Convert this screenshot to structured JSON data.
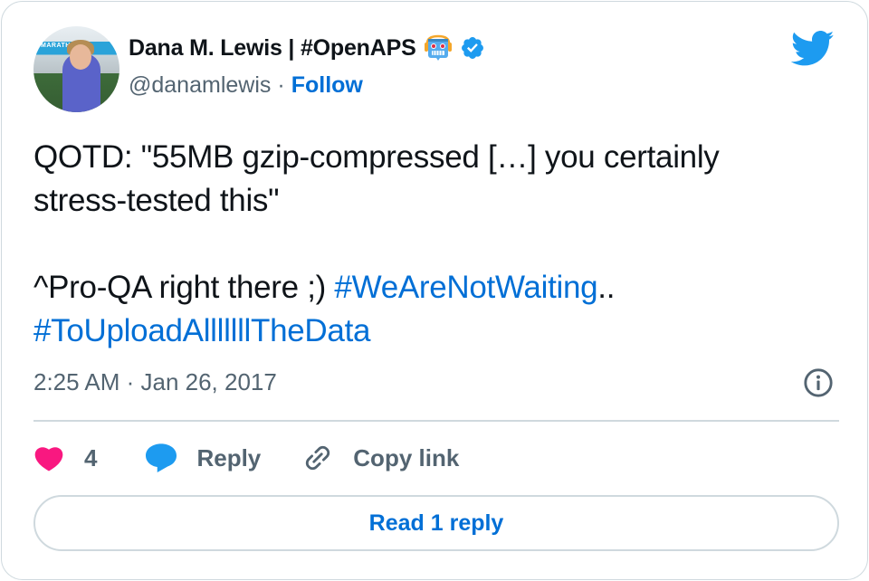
{
  "author": {
    "display_name": "Dana M. Lewis | #OpenAPS",
    "name_emoji": "robot-emoji",
    "verified": true,
    "handle": "@danamlewis",
    "separator": "·",
    "follow_label": "Follow",
    "avatar_banner_text": "MARATHON"
  },
  "brand": {
    "logo": "twitter-bird-icon",
    "accent_color": "#1d9bf0",
    "link_color": "#006fd6"
  },
  "tweet": {
    "line1": "QOTD: \"55MB gzip-compressed […] you certainly",
    "line2": "stress-tested this\"",
    "line3_prefix": "^Pro-QA right there ;) ",
    "hashtag1": "#WeAreNotWaiting",
    "line3_suffix": "..",
    "hashtag2": "#ToUploadAlllllllTheData"
  },
  "meta": {
    "timestamp": "2:25 AM · Jan 26, 2017",
    "info_icon": "info-icon"
  },
  "actions": {
    "like_count": "4",
    "like_color": "#f91880",
    "reply_label": "Reply",
    "copy_link_label": "Copy link"
  },
  "read_replies_label": "Read 1 reply"
}
